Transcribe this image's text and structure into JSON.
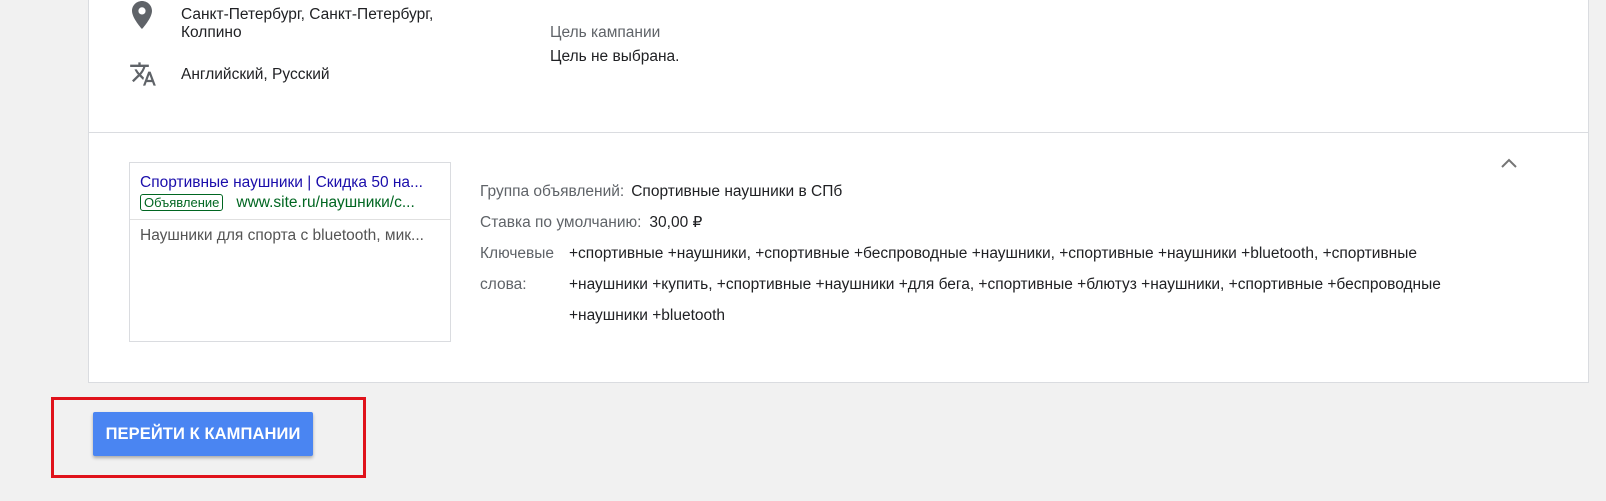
{
  "summary": {
    "location": "Санкт-Петербург, Санкт-Петербург, Колпино",
    "languages": "Английский, Русский",
    "goal_label": "Цель кампании",
    "goal_value": "Цель не выбрана.",
    "location_icon": "location-pin-icon",
    "language_icon": "translate-icon"
  },
  "ad_preview": {
    "title": "Спортивные наушники | Скидка 50 на...",
    "badge": "Объявление",
    "url": "www.site.ru/наушники/с...",
    "description": "Наушники для спорта с bluetooth, мик..."
  },
  "ad_group": {
    "group_label": "Группа объявлений:",
    "group_value": "Спортивные наушники в СПб",
    "bid_label": "Ставка по умолчанию:",
    "bid_value": "30,00 ₽",
    "keywords_label": "Ключевые слова:",
    "keywords_value": "+спортивные +наушники, +спортивные +беспроводные +наушники, +спортивные +наушники +bluetooth, +спортивные +наушники +купить, +спортивные +наушники +для бега, +спортивные +блютуз +наушники, +спортивные +беспроводные +наушники +bluetooth",
    "collapse_icon": "chevron-up-icon"
  },
  "actions": {
    "go_to_campaign": "ПЕРЕЙТИ К КАМПАНИИ"
  },
  "colors": {
    "button": "#4a85f2",
    "highlight": "#e0121b",
    "ad_title": "#1a0dab",
    "ad_url": "#006621"
  }
}
